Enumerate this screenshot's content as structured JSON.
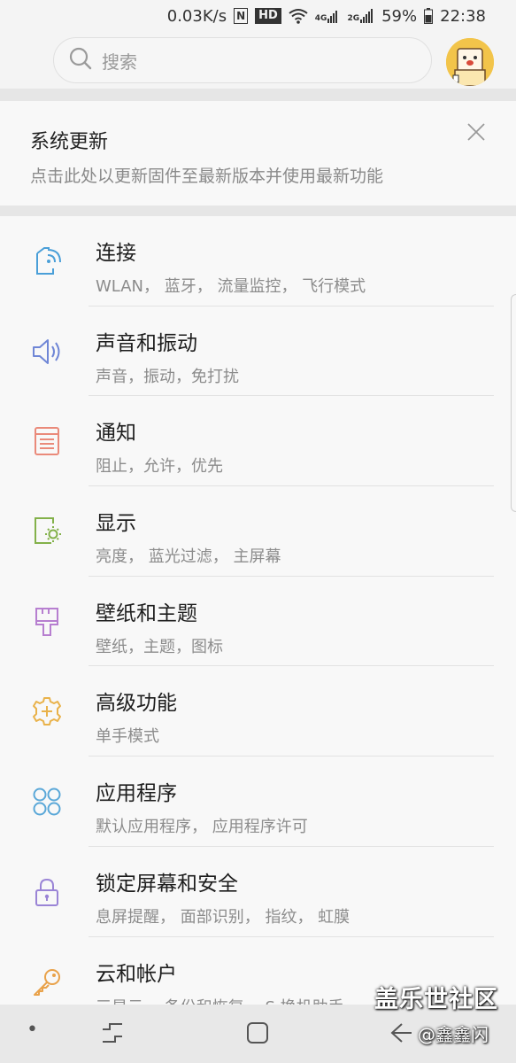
{
  "status_bar": {
    "network_speed": "0.03K/s",
    "nfc": "N",
    "hd": "HD",
    "signal_label_1": "4G",
    "signal_label_2": "2G",
    "battery_percent": "59%",
    "time": "22:38"
  },
  "search": {
    "placeholder": "搜索",
    "search_icon": "search-icon"
  },
  "profile": {
    "icon": "avatar"
  },
  "update_notice": {
    "title": "系统更新",
    "subtitle": "点击此处以更新固件至最新版本并使用最新功能",
    "close_icon": "close-icon"
  },
  "settings": [
    {
      "title": "连接",
      "subtitle": "WLAN， 蓝牙， 流量监控， 飞行模式",
      "icon": "connections-icon",
      "color": "#4a9fd8"
    },
    {
      "title": "声音和振动",
      "subtitle": "声音，振动，免打扰",
      "icon": "speaker-icon",
      "color": "#6f86d6"
    },
    {
      "title": "通知",
      "subtitle": "阻止，允许，优先",
      "icon": "notification-icon",
      "color": "#ea8a7a"
    },
    {
      "title": "显示",
      "subtitle": "亮度， 蓝光过滤， 主屏幕",
      "icon": "display-icon",
      "color": "#83b14a"
    },
    {
      "title": "壁纸和主题",
      "subtitle": "壁纸，主题，图标",
      "icon": "paintbrush-icon",
      "color": "#b77fd0"
    },
    {
      "title": "高级功能",
      "subtitle": "单手模式",
      "icon": "advanced-gear-icon",
      "color": "#e9b24a"
    },
    {
      "title": "应用程序",
      "subtitle": "默认应用程序， 应用程序许可",
      "icon": "apps-icon",
      "color": "#5ba8d8"
    },
    {
      "title": "锁定屏幕和安全",
      "subtitle": "息屏提醒， 面部识别， 指纹， 虹膜",
      "icon": "lock-icon",
      "color": "#9a84d6"
    },
    {
      "title": "云和帐户",
      "subtitle": "三星云， 备份和恢复， S 换机助手",
      "icon": "key-icon",
      "color": "#e9a24a"
    }
  ],
  "watermark": {
    "site": "盖乐世社区",
    "user": "@鑫鑫闪"
  },
  "navigation": {
    "dot": "•",
    "recent_icon": "recent-apps-icon",
    "home_icon": "home-icon",
    "back_icon": "back-icon"
  }
}
